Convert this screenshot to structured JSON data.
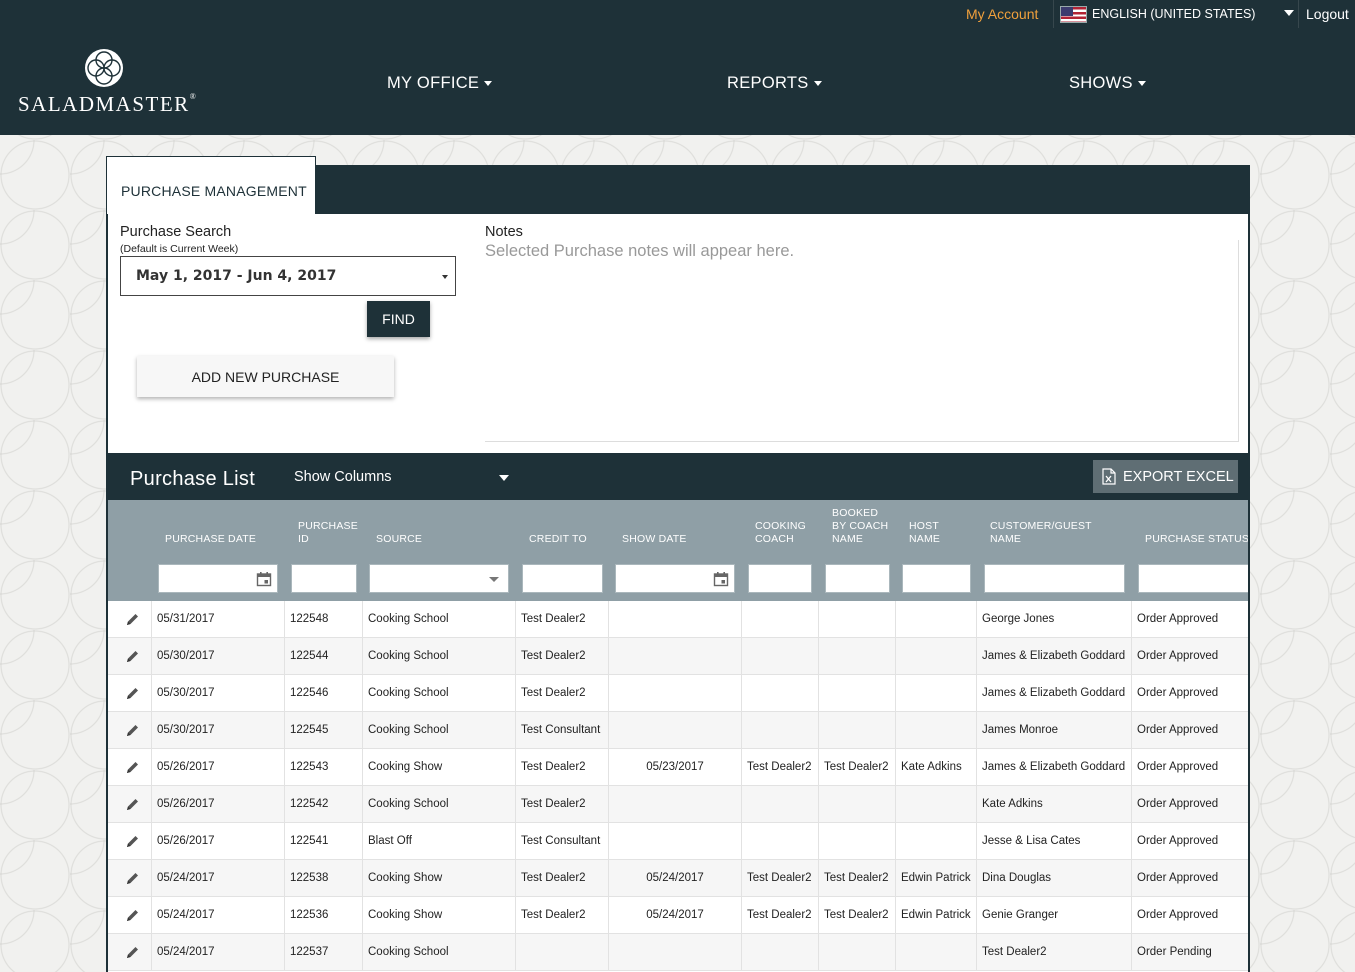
{
  "header": {
    "my_account": "My Account",
    "language": "ENGLISH (UNITED STATES)",
    "logout": "Logout",
    "logo_text": "SALADMASTER",
    "logo_mark": "®",
    "nav": [
      "MY OFFICE",
      "REPORTS",
      "SHOWS"
    ]
  },
  "panel": {
    "tab_label": "PURCHASE MANAGEMENT",
    "search_label": "Purchase Search",
    "search_sub": "(Default is Current Week)",
    "date_range": "May 1, 2017 - Jun 4, 2017",
    "find_label": "FIND",
    "add_label": "ADD NEW PURCHASE",
    "notes_label": "Notes",
    "notes_placeholder": "Selected Purchase notes will appear here."
  },
  "list": {
    "title": "Purchase List",
    "show_columns": "Show Columns",
    "export_label": "EXPORT EXCEL",
    "columns": [
      "PURCHASE DATE",
      "PURCHASE ID",
      "SOURCE",
      "CREDIT TO",
      "SHOW DATE",
      "COOKING COACH",
      "BOOKED BY COACH NAME",
      "HOST NAME",
      "CUSTOMER/GUEST NAME",
      "PURCHASE STATUS"
    ],
    "rows": [
      [
        "05/31/2017",
        "122548",
        "Cooking School",
        "Test Dealer2",
        "",
        "",
        "",
        "",
        "George Jones",
        "Order Approved"
      ],
      [
        "05/30/2017",
        "122544",
        "Cooking School",
        "Test Dealer2",
        "",
        "",
        "",
        "",
        "James & Elizabeth Goddard",
        "Order Approved"
      ],
      [
        "05/30/2017",
        "122546",
        "Cooking School",
        "Test Dealer2",
        "",
        "",
        "",
        "",
        "James & Elizabeth Goddard",
        "Order Approved"
      ],
      [
        "05/30/2017",
        "122545",
        "Cooking School",
        "Test Consultant",
        "",
        "",
        "",
        "",
        "James Monroe",
        "Order Approved"
      ],
      [
        "05/26/2017",
        "122543",
        "Cooking Show",
        "Test Dealer2",
        "05/23/2017",
        "Test Dealer2",
        "Test Dealer2",
        "Kate Adkins",
        "James & Elizabeth Goddard",
        "Order Approved"
      ],
      [
        "05/26/2017",
        "122542",
        "Cooking School",
        "Test Dealer2",
        "",
        "",
        "",
        "",
        "Kate Adkins",
        "Order Approved"
      ],
      [
        "05/26/2017",
        "122541",
        "Blast Off",
        "Test Consultant",
        "",
        "",
        "",
        "",
        "Jesse & Lisa Cates",
        "Order Approved"
      ],
      [
        "05/24/2017",
        "122538",
        "Cooking Show",
        "Test Dealer2",
        "05/24/2017",
        "Test Dealer2",
        "Test Dealer2",
        "Edwin Patrick",
        "Dina Douglas",
        "Order Approved"
      ],
      [
        "05/24/2017",
        "122536",
        "Cooking Show",
        "Test Dealer2",
        "05/24/2017",
        "Test Dealer2",
        "Test Dealer2",
        "Edwin Patrick",
        "Genie Granger",
        "Order Approved"
      ],
      [
        "05/24/2017",
        "122537",
        "Cooking School",
        "",
        "",
        "",
        "",
        "",
        "Test Dealer2",
        "Order Pending"
      ]
    ]
  }
}
